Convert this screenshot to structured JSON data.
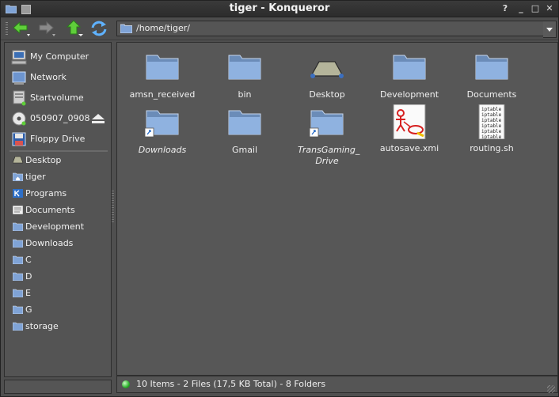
{
  "window": {
    "title": "tiger - Konqueror",
    "buttons": {
      "help": "?",
      "minimize": "_",
      "maximize": "□",
      "close": "✕"
    }
  },
  "toolbar": {
    "location": "/home/tiger/",
    "back_icon": "back-arrow-icon",
    "forward_icon": "forward-arrow-icon",
    "up_icon": "up-arrow-icon",
    "reload_icon": "reload-icon"
  },
  "sidebar": {
    "devices": [
      {
        "label": "My Computer",
        "icon": "computer-icon"
      },
      {
        "label": "Network",
        "icon": "network-icon"
      },
      {
        "label": "Startvolume",
        "icon": "harddisk-icon"
      },
      {
        "label": "050907_0908",
        "icon": "cdrom-icon",
        "eject": true
      },
      {
        "label": "Floppy Drive",
        "icon": "floppy-icon"
      }
    ],
    "tree": [
      {
        "label": "Desktop",
        "icon": "desktop-icon"
      },
      {
        "label": "tiger",
        "icon": "home-folder-icon"
      },
      {
        "label": "Programs",
        "icon": "kde-icon"
      },
      {
        "label": "Documents",
        "icon": "document-icon"
      },
      {
        "label": "Development",
        "icon": "folder-icon"
      },
      {
        "label": "Downloads",
        "icon": "folder-icon"
      },
      {
        "label": "C",
        "icon": "folder-icon"
      },
      {
        "label": "D",
        "icon": "folder-icon"
      },
      {
        "label": "E",
        "icon": "folder-icon"
      },
      {
        "label": "G",
        "icon": "folder-icon"
      },
      {
        "label": "storage",
        "icon": "folder-icon"
      }
    ]
  },
  "files": [
    {
      "name": "amsn_received",
      "type": "folder"
    },
    {
      "name": "bin",
      "type": "folder"
    },
    {
      "name": "Desktop",
      "type": "desktop"
    },
    {
      "name": "Development",
      "type": "folder"
    },
    {
      "name": "Documents",
      "type": "folder"
    },
    {
      "name": "Downloads",
      "type": "folder-link",
      "italic": true
    },
    {
      "name": "Gmail",
      "type": "folder"
    },
    {
      "name": "TransGaming_ Drive",
      "type": "folder-link",
      "italic": true
    },
    {
      "name": "autosave.xmi",
      "type": "xmi"
    },
    {
      "name": "routing.sh",
      "type": "script"
    }
  ],
  "script_preview_text": "iptable",
  "status": {
    "text": "10 Items - 2 Files (17,5 KB Total) - 8 Folders"
  }
}
